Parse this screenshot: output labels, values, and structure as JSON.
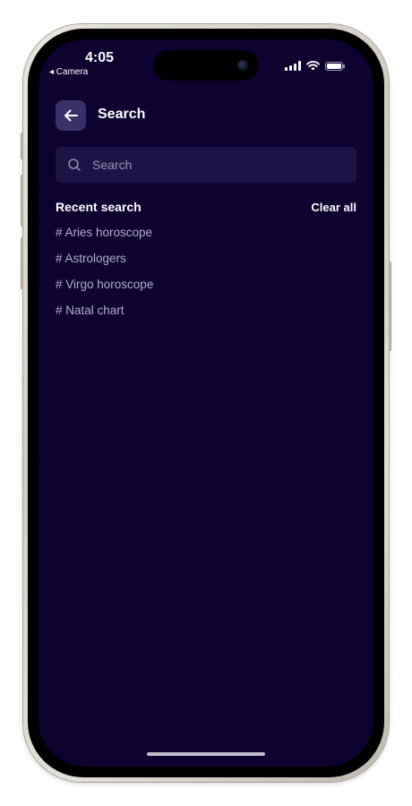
{
  "status_bar": {
    "time": "4:05",
    "back_app": "◂ Camera",
    "signal_bars": 4,
    "battery_level": 1.0
  },
  "header": {
    "title": "Search",
    "back_icon": "arrow-left-icon"
  },
  "search": {
    "placeholder": "Search",
    "value": "",
    "icon": "search-icon"
  },
  "recent": {
    "title": "Recent search",
    "clear_label": "Clear all",
    "items": [
      {
        "label": "# Aries horoscope"
      },
      {
        "label": "# Astrologers"
      },
      {
        "label": "# Virgo horoscope"
      },
      {
        "label": "# Natal chart"
      }
    ]
  },
  "colors": {
    "background": "#0d0230",
    "search_bg": "#1d1345",
    "back_button_bg": "#3a3166",
    "muted_text": "#b3aecb"
  }
}
